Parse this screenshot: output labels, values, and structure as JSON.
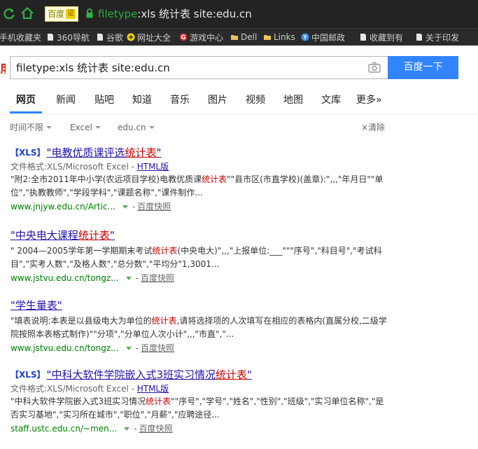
{
  "browser": {
    "badge_text": "百度",
    "cert_text": "证",
    "url_scheme": "filetype",
    "url_rest": ":xls 统计表 site:edu.cn",
    "bookmarks": [
      {
        "label": "手机收藏夹",
        "icon": "folder-icon"
      },
      {
        "label": "360导航",
        "icon": "page-icon"
      },
      {
        "label": "谷歌",
        "icon": "page-icon"
      },
      {
        "label": "网址大全",
        "icon": "plus-circle-icon"
      },
      {
        "label": "游戏中心",
        "icon": "g-icon"
      },
      {
        "label": "Dell",
        "icon": "folder-icon"
      },
      {
        "label": "Links",
        "icon": "folder-icon"
      },
      {
        "label": "中国邮政",
        "icon": "postal-icon"
      },
      {
        "label": "收藏到有",
        "icon": "page-icon"
      },
      {
        "label": "关于印发",
        "icon": "page-icon"
      }
    ]
  },
  "search": {
    "query": "filetype:xls 统计表 site:edu.cn",
    "button_label": "百度一下"
  },
  "tabs": [
    "网页",
    "新闻",
    "贴吧",
    "知道",
    "音乐",
    "图片",
    "视频",
    "地图",
    "文库",
    "更多»"
  ],
  "filters": {
    "time": "时间不限",
    "format": "Excel",
    "site": "edu.cn",
    "clear": "×清除"
  },
  "results": [
    {
      "tag": "【XLS】",
      "title_pre": "\"电教优质课评选",
      "title_hl": "统计表",
      "title_post": "\"",
      "meta_label": "文件格式:XLS/Microsoft Excel - ",
      "meta_link": "HTML版",
      "abstract_1a": "\"附2:全市2011年中小学(农远项目学校)电教优质课",
      "abstract_1hl": "统计表",
      "abstract_1b": "\"\"县市区(市直学校)(盖章):\",,,\"年月日\"\"单位\",\"执教教师\",\"学段学科\",\"课题名称\",\"课件制作...",
      "url": "www.jnjyw.edu.cn/Artic...",
      "snapshot": "百度快照"
    },
    {
      "tag": "",
      "title_pre": "\"中央电大课程",
      "title_hl": "统计表",
      "title_post": "\"",
      "abstract_1a": "\" 2004—2005学年第一学期期末考试",
      "abstract_1hl": "统计表",
      "abstract_1b": "(中央电大)\",,,\"上报单位:___\"\"\"序号\",\"科目号\",\"考试科目\",\"实考人数\",\"及格人数\",\"总分数\",\"平均分\"1,3001...",
      "url": "www.jstvu.edu.cn/tongz...",
      "snapshot": "百度快照"
    },
    {
      "tag": "",
      "title_pre": "\"学生量表\"",
      "title_hl": "",
      "title_post": "",
      "abstract_1a": "\"填表说明:本表是以县级电大为单位的",
      "abstract_1hl": "统计表",
      "abstract_1b": ",请将选择项的人次填写在相应的表格内(直属分校,二级学院按照本表格式制作)\"\"分项\",\"分单位人次小计\",,,\"市直\",\"...",
      "url": "www.jstvu.edu.cn/tongz...",
      "snapshot": "百度快照"
    },
    {
      "tag": "【XLS】",
      "title_pre": "\"中科大软件学院嵌入式3班实习情况",
      "title_hl": "统计表",
      "title_post": "\"",
      "meta_label": "文件格式:XLS/Microsoft Excel - ",
      "meta_link": "HTML版",
      "abstract_1a": "\"中科大软件学院嵌入式3班实习情况",
      "abstract_1hl": "统计表",
      "abstract_1b": "\"\"序号\",\"学号\",\"姓名\",\"性别\",\"班级\",\"实习单位名称\",\"是否实习基地\",\"实习所在城市\",\"职位\",\"月薪\",\"应聘途径...",
      "url": "staff.ustc.edu.cn/~men...",
      "snapshot": "百度快照"
    }
  ]
}
